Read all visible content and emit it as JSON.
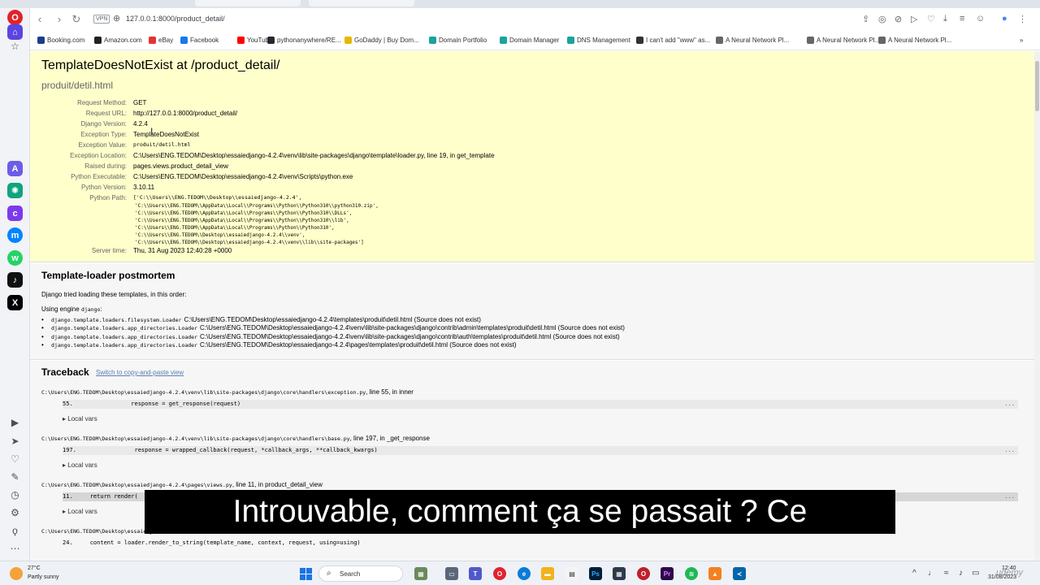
{
  "browser": {
    "vpn_label": "VPN",
    "url": "127.0.0.1:8000/product_detail/",
    "bookmarks": [
      {
        "label": "Booking.com",
        "color": "#1a3e8c"
      },
      {
        "label": "Amazon.com",
        "color": "#222222"
      },
      {
        "label": "eBay",
        "color": "#e53238"
      },
      {
        "label": "Facebook",
        "color": "#1877f2"
      },
      {
        "label": "YouTube",
        "color": "#ff0000"
      },
      {
        "label": "pythonanywhere/RE...",
        "color": "#24292f"
      },
      {
        "label": "GoDaddy | Buy Dom...",
        "color": "#e5b800"
      },
      {
        "label": "Domain Portfolio",
        "color": "#1ba39c"
      },
      {
        "label": "Domain Manager",
        "color": "#1ba39c"
      },
      {
        "label": "DNS Management",
        "color": "#1ba39c"
      },
      {
        "label": "I can't add \"www\" as...",
        "color": "#333333"
      },
      {
        "label": "A Neural Network Pl...",
        "color": "#666666"
      },
      {
        "label": "A Neural Network Pl...",
        "color": "#666666"
      },
      {
        "label": "A Neural Network Pl...",
        "color": "#666666"
      }
    ]
  },
  "error": {
    "title": "TemplateDoesNotExist at /product_detail/",
    "subtitle": "produit/detil.html",
    "meta": [
      {
        "key": "Request Method:",
        "value": "GET"
      },
      {
        "key": "Request URL:",
        "value": "http://127.0.0.1:8000/product_detail/"
      },
      {
        "key": "Django Version:",
        "value": "4.2.4"
      },
      {
        "key": "Exception Type:",
        "value": "TemplateDoesNotExist"
      },
      {
        "key": "Exception Value:",
        "value": "produit/detil.html"
      },
      {
        "key": "Exception Location:",
        "value": "C:\\Users\\ENG.TEDOM\\Desktop\\essaiedjango-4.2.4\\venv\\lib\\site-packages\\django\\template\\loader.py, line 19, in get_template"
      },
      {
        "key": "Raised during:",
        "value": "pages.views.product_detail_view"
      },
      {
        "key": "Python Executable:",
        "value": "C:\\Users\\ENG.TEDOM\\Desktop\\essaiedjango-4.2.4\\venv\\Scripts\\python.exe"
      },
      {
        "key": "Python Version:",
        "value": "3.10.11"
      },
      {
        "key": "Python Path:",
        "value": "['C:\\\\Users\\\\ENG.TEDOM\\\\Desktop\\\\essaiedjango-4.2.4',"
      },
      {
        "key": "Server time:",
        "value": "Thu, 31 Aug 2023 12:40:28 +0000"
      }
    ],
    "python_path_lines": [
      "'C:\\\\Users\\\\ENG.TEDOM\\\\AppData\\\\Local\\\\Programs\\\\Python\\\\Python310\\\\python310.zip',",
      "'C:\\\\Users\\\\ENG.TEDOM\\\\AppData\\\\Local\\\\Programs\\\\Python\\\\Python310\\\\DLLs',",
      "'C:\\\\Users\\\\ENG.TEDOM\\\\AppData\\\\Local\\\\Programs\\\\Python\\\\Python310\\\\lib',",
      "'C:\\\\Users\\\\ENG.TEDOM\\\\AppData\\\\Local\\\\Programs\\\\Python\\\\Python310',",
      "'C:\\\\Users\\\\ENG.TEDOM\\\\Desktop\\\\essaiedjango-4.2.4\\\\venv',",
      "'C:\\\\Users\\\\ENG.TEDOM\\\\Desktop\\\\essaiedjango-4.2.4\\\\venv\\\\lib\\\\site-packages']"
    ]
  },
  "postmortem": {
    "title": "Template-loader postmortem",
    "intro": "Django tried loading these templates, in this order:",
    "engine_prefix": "Using engine",
    "engine_name": "django",
    "items": [
      {
        "loader": "django.template.loaders.filesystem.Loader",
        "path": "C:\\Users\\ENG.TEDOM\\Desktop\\essaiedjango-4.2.4\\templates\\produit\\detil.html (Source does not exist)"
      },
      {
        "loader": "django.template.loaders.app_directories.Loader",
        "path": "C:\\Users\\ENG.TEDOM\\Desktop\\essaiedjango-4.2.4\\venv\\lib\\site-packages\\django\\contrib\\admin\\templates\\produit\\detil.html (Source does not exist)"
      },
      {
        "loader": "django.template.loaders.app_directories.Loader",
        "path": "C:\\Users\\ENG.TEDOM\\Desktop\\essaiedjango-4.2.4\\venv\\lib\\site-packages\\django\\contrib\\auth\\templates\\produit\\detil.html (Source does not exist)"
      },
      {
        "loader": "django.template.loaders.app_directories.Loader",
        "path": "C:\\Users\\ENG.TEDOM\\Desktop\\essaiedjango-4.2.4\\pages\\templates\\produit\\detil.html (Source does not exist)"
      }
    ]
  },
  "traceback": {
    "title": "Traceback",
    "switch_link": "Switch to copy-and-paste view",
    "local_vars": "Local vars",
    "ellipsis": "...",
    "frames": [
      {
        "file": "C:\\Users\\ENG.TEDOM\\Desktop\\essaiedjango-4.2.4\\venv\\lib\\site-packages\\django\\core\\handlers\\exception.py",
        "where": ", line 55, in inner",
        "line": "55.                 response = get_response(request)"
      },
      {
        "file": "C:\\Users\\ENG.TEDOM\\Desktop\\essaiedjango-4.2.4\\venv\\lib\\site-packages\\django\\core\\handlers\\base.py",
        "where": ", line 197, in _get_response",
        "line": "197.                 response = wrapped_callback(request, *callback_args, **callback_kwargs)"
      },
      {
        "file": "C:\\Users\\ENG.TEDOM\\Desktop\\essaiedjango-4.2.4\\pages\\views.py",
        "where": ", line 11, in product_detail_view",
        "line": "11.     return render("
      },
      {
        "file": "C:\\Users\\ENG.TEDOM\\Desktop\\essaiedj",
        "where": "",
        "line": "24.     content = loader.render_to_string(template_name, context, request, using=using)"
      }
    ]
  },
  "subtitle": "Introuvable, comment ça se passait ? Ce",
  "taskbar": {
    "temperature": "27°C",
    "weather": "Partly sunny",
    "search": "Search",
    "time": "12:40",
    "date": "31/08/2023",
    "watermark": "udemy"
  }
}
